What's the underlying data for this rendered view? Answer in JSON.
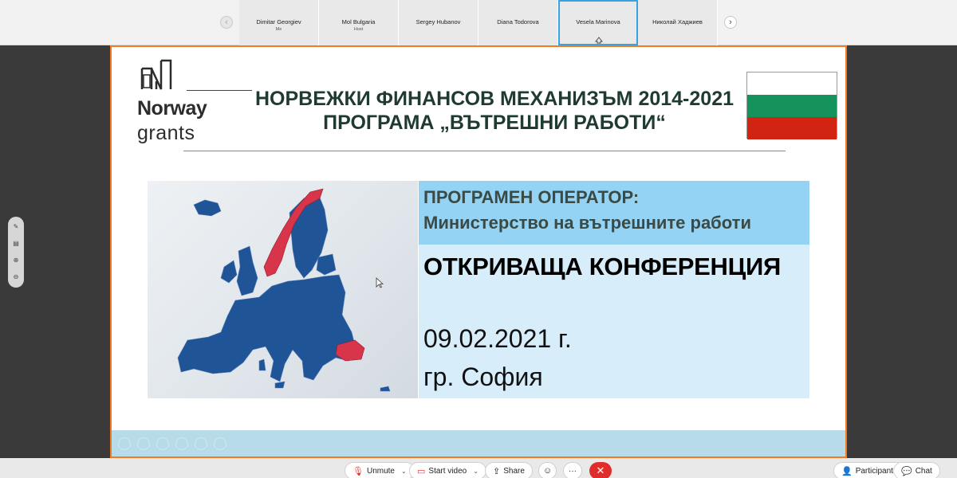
{
  "participants": [
    {
      "name": "Dimitar Georgiev",
      "sub": "Me",
      "active": false
    },
    {
      "name": "Mol Bulgaria",
      "sub": "Host",
      "active": false
    },
    {
      "name": "Sergey Hubanov",
      "sub": "",
      "active": false
    },
    {
      "name": "Diana Todorova",
      "sub": "",
      "active": false
    },
    {
      "name": "Vesela Marinova",
      "sub": "",
      "active": true
    },
    {
      "name": "Николай Хаджиев",
      "sub": "",
      "active": false
    }
  ],
  "nav": {
    "prev": "‹",
    "next": "›"
  },
  "slide": {
    "logo_word1": "Norway",
    "logo_word2": "grants",
    "title_line1": "НОРВЕЖКИ ФИНАНСОВ МЕХАНИЗЪМ 2014-2021",
    "title_line2": "ПРОГРАМА „ВЪТРЕШНИ РАБОТИ“",
    "operator_label": "ПРОГРАМЕН ОПЕРАТОР:",
    "operator_name": "Министерство на вътрешните работи",
    "conference_title": "ОТКРИВАЩА КОНФЕРЕНЦИЯ",
    "date": "09.02.2021 г.",
    "city": "гр. София",
    "flag_colors": [
      "#ffffff",
      "#14945c",
      "#d22412"
    ],
    "map_colors": {
      "eu": "#1f5496",
      "highlight": "#d8344a"
    }
  },
  "controls": {
    "unmute": "Unmute",
    "start_video": "Start video",
    "share": "Share",
    "more": "···",
    "participants": "Participants",
    "chat": "Chat"
  },
  "colors": {
    "share_border": "#f47b20",
    "active_tile": "#36a4e3",
    "leave": "#e12c2c"
  }
}
